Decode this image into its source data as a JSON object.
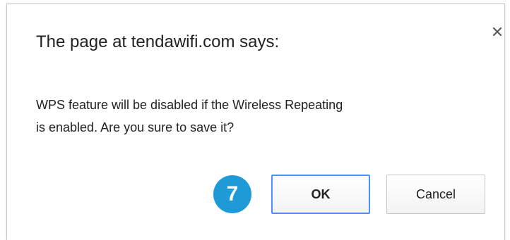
{
  "dialog": {
    "title": "The page at tendawifi.com says:",
    "message_line1": "WPS feature will be disabled if the Wireless Repeating",
    "message_line2": "is enabled. Are you sure to save it?",
    "close_icon": "close-icon",
    "badge_number": "7",
    "ok_label": "OK",
    "cancel_label": "Cancel"
  },
  "colors": {
    "badge": "#1e9bd7",
    "ok_focus_border": "#4d90fe"
  }
}
